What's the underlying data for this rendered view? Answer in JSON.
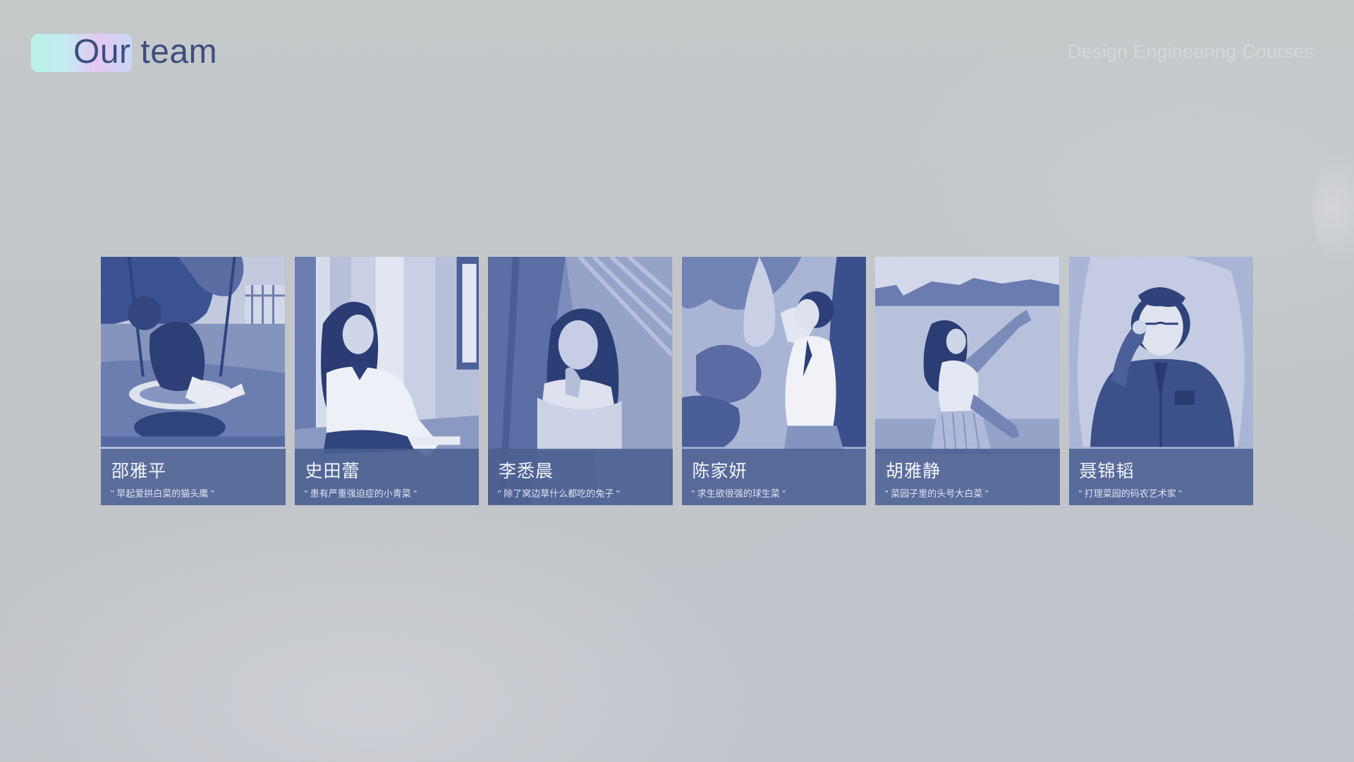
{
  "header": {
    "title": "Our team",
    "course": "Design Engineering Courses"
  },
  "colors": {
    "title": "#3c4e80",
    "course_title": "#d4d7da",
    "caption_bg": "#4b6091",
    "card_dark": "#3a4f88",
    "card_mid": "#6c7fb0",
    "card_light": "#c4cbe2"
  },
  "team": [
    {
      "name": "邵雅平",
      "quote": "\" 早起爱拱白菜的猫头鹰 \""
    },
    {
      "name": "史田蕾",
      "quote": "\" 患有严重强迫症的小青菜 \""
    },
    {
      "name": "李悉晨",
      "quote": "\" 除了窝边草什么都吃的兔子 \""
    },
    {
      "name": "陈家妍",
      "quote": "\" 求生欲很强的球生菜 \""
    },
    {
      "name": "胡雅静",
      "quote": "\" 菜园子里的头号大白菜 \""
    },
    {
      "name": "聂锦韬",
      "quote": "\" 打理菜园的码农艺术家 \""
    }
  ]
}
